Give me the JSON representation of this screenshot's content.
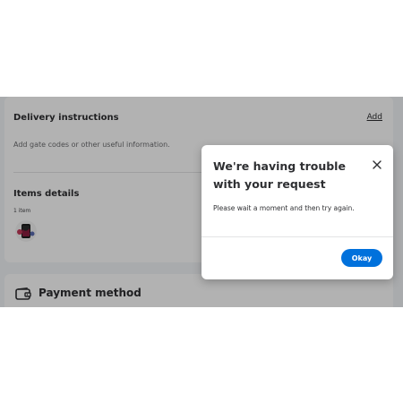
{
  "delivery": {
    "title": "Delivery instructions",
    "add_label": "Add",
    "hint": "Add gate codes or other useful information."
  },
  "items": {
    "title": "Items details",
    "count": "1 item"
  },
  "payment": {
    "title": "Payment method"
  },
  "modal": {
    "title": "We're having trouble with your request",
    "body": "Please wait a moment and then try again.",
    "okay_label": "Okay"
  },
  "colors": {
    "page_background": "#f2f5f8",
    "card_background": "#ffffff",
    "primary_button": "#0071dc",
    "text_primary": "#2e2f32",
    "overlay": "rgba(0,0,0,0.3)"
  },
  "icons": {
    "close": "close-icon",
    "wallet": "wallet-icon"
  }
}
